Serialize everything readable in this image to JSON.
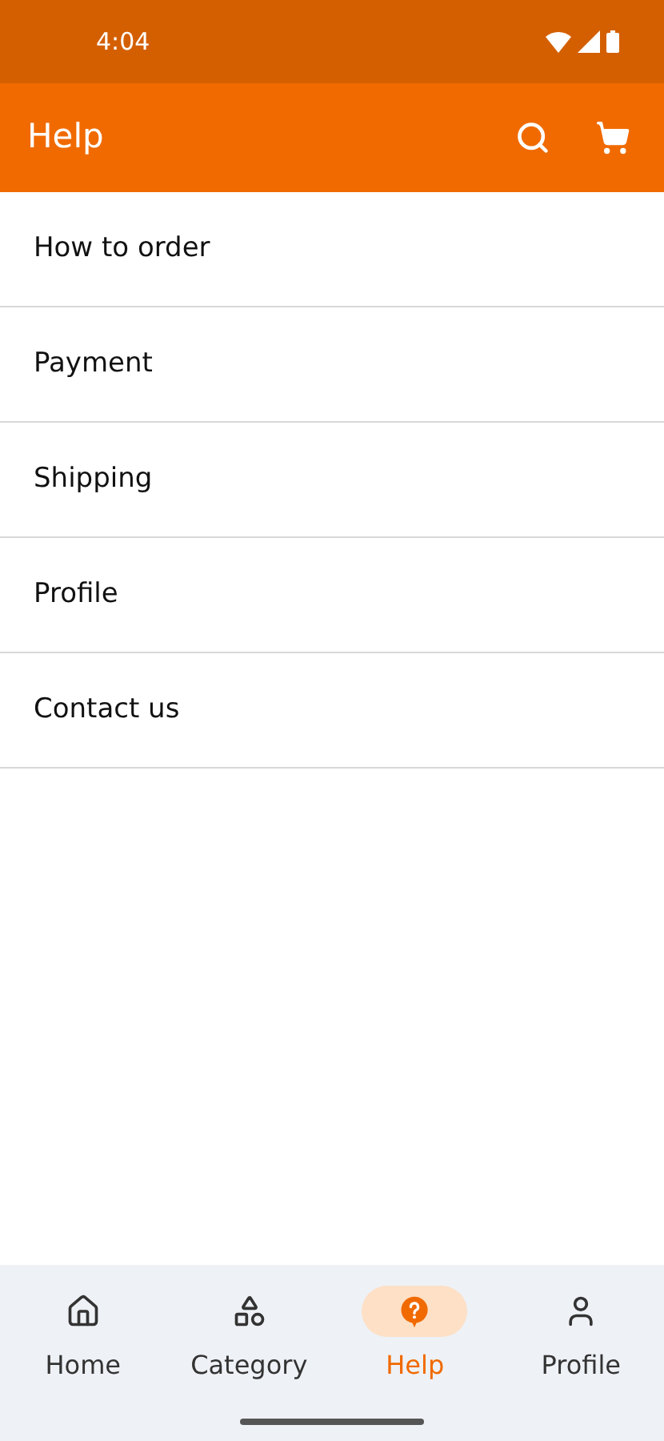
{
  "status_bar": {
    "time": "4:04"
  },
  "app_bar": {
    "title": "Help"
  },
  "help_items": [
    {
      "label": "How to order"
    },
    {
      "label": "Payment"
    },
    {
      "label": "Shipping"
    },
    {
      "label": "Profile"
    },
    {
      "label": "Contact us"
    }
  ],
  "bottom_nav": [
    {
      "kind": "home",
      "label": "Home",
      "selected": false
    },
    {
      "kind": "category",
      "label": "Category",
      "selected": false
    },
    {
      "kind": "help",
      "label": "Help",
      "selected": true
    },
    {
      "kind": "profile",
      "label": "Profile",
      "selected": false
    }
  ]
}
